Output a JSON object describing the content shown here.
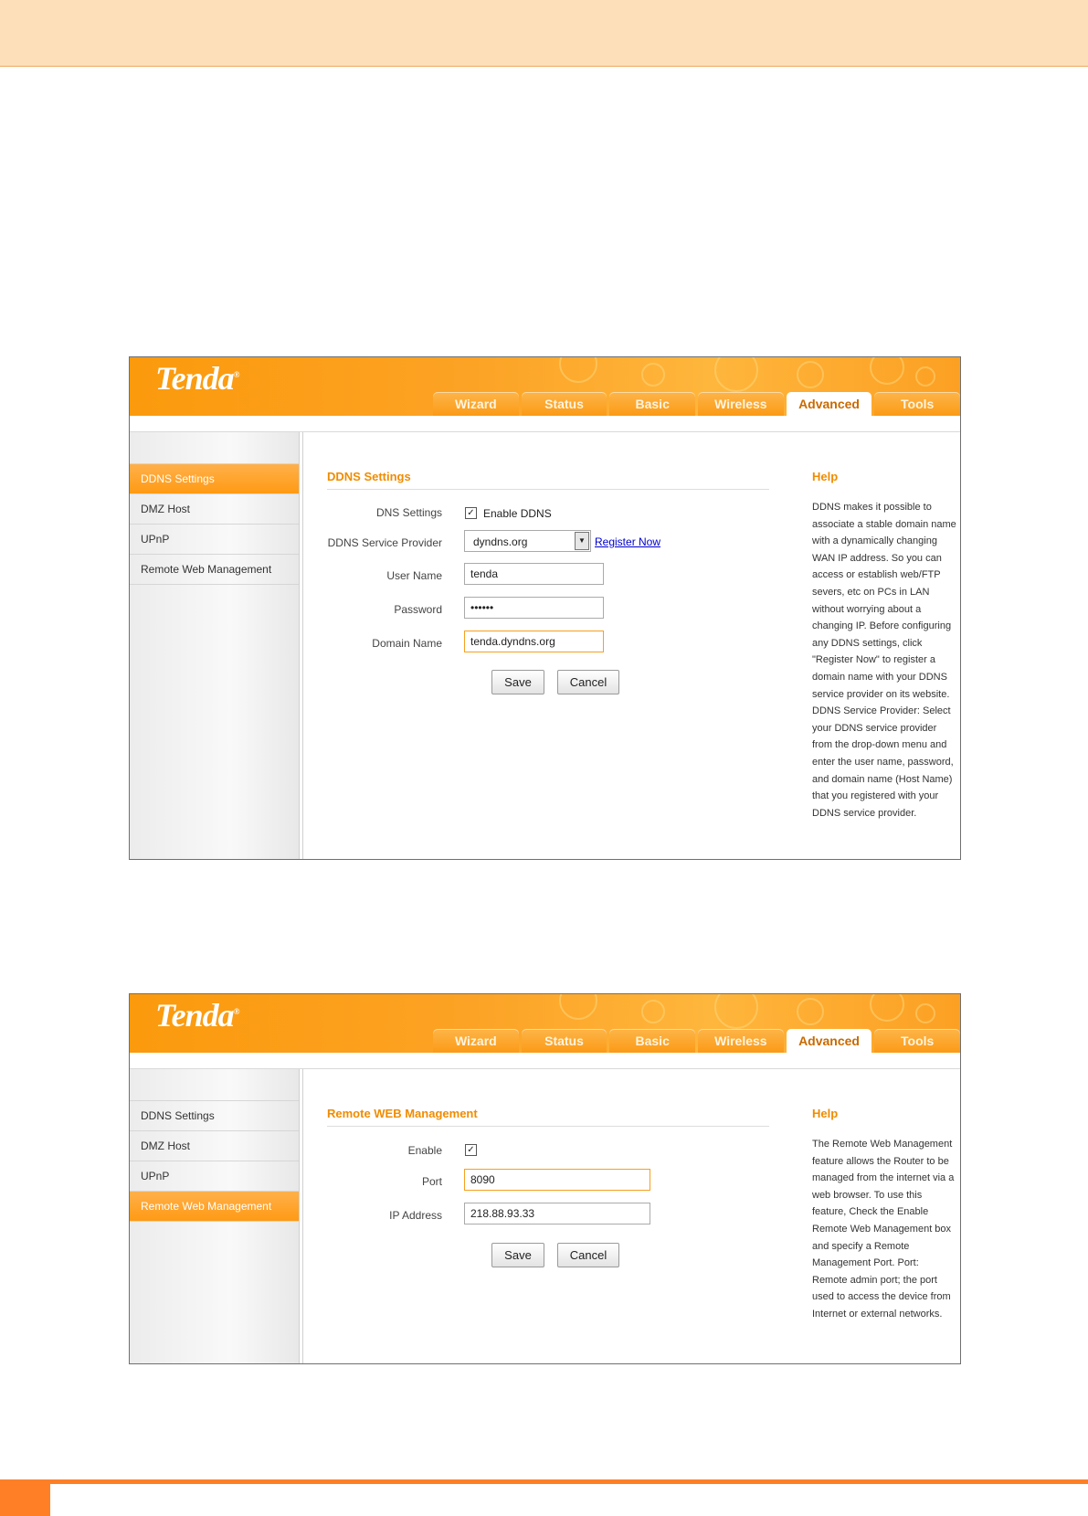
{
  "brand": {
    "logo": "Tenda",
    "trademark": "®"
  },
  "nav_tabs": [
    "Wizard",
    "Status",
    "Basic",
    "Wireless",
    "Advanced",
    "Tools"
  ],
  "active_tab": "Advanced",
  "sidebar": [
    "DDNS Settings",
    "DMZ Host",
    "UPnP",
    "Remote Web Management"
  ],
  "colors": {
    "accent": "#fb9a0c",
    "title": "#f08c00",
    "band": "#fde0b9",
    "rule": "#ff7f27"
  },
  "ddns_page": {
    "active_item": "DDNS Settings",
    "title": "DDNS Settings",
    "dns_settings_label": "DNS Settings",
    "enable_ddns_label": "Enable DDNS",
    "enable_ddns_checked": true,
    "provider_label": "DDNS Service Provider",
    "provider_value": "dyndns.org",
    "register_link": "Register Now",
    "username_label": "User Name",
    "username_value": "tenda",
    "password_label": "Password",
    "password_value": "••••••",
    "domain_label": "Domain Name",
    "domain_value": "tenda.dyndns.org",
    "save_label": "Save",
    "cancel_label": "Cancel",
    "help_title": "Help",
    "help_text": "DDNS makes it possible to associate a stable domain name with a dynamically changing WAN IP address. So you can access or establish web/FTP severs, etc on PCs in LAN without worrying about a changing IP. Before configuring any DDNS settings, click \"Register Now\" to register a domain name with your DDNS service provider on its website. DDNS Service Provider: Select your DDNS service provider from the drop-down menu and enter the user name, password, and domain name (Host Name) that you registered with your DDNS service provider."
  },
  "remote_page": {
    "active_item": "Remote Web Management",
    "title": "Remote WEB Management",
    "enable_label": "Enable",
    "enable_checked": true,
    "port_label": "Port",
    "port_value": "8090",
    "ip_label": "IP Address",
    "ip_value": "218.88.93.33",
    "save_label": "Save",
    "cancel_label": "Cancel",
    "help_title": "Help",
    "help_text": "The Remote Web Management feature allows the Router to be managed from the internet via a web browser. To use this feature, Check the Enable Remote Web Management box and specify a Remote Management Port. Port: Remote admin port; the port used to access the device from Internet or external networks."
  }
}
